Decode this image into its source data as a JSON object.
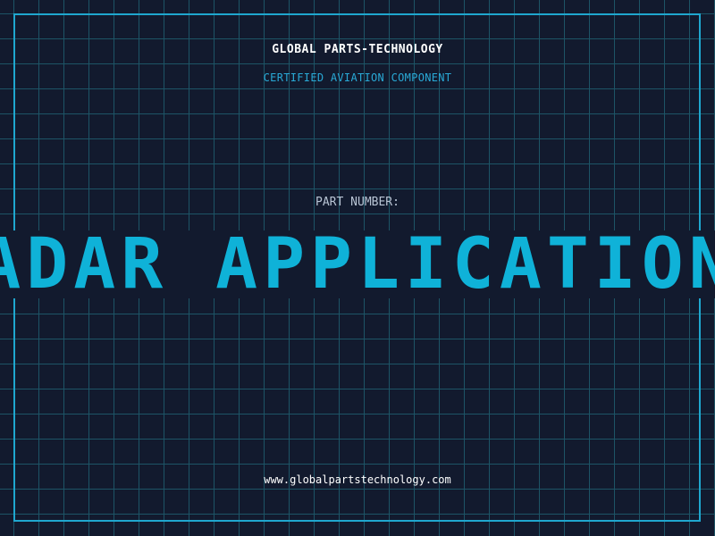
{
  "header": {
    "company": "GLOBAL PARTS-TECHNOLOGY",
    "subtitle": "CERTIFIED AVIATION COMPONENT"
  },
  "part": {
    "label": "PART NUMBER:",
    "value": "RADAR APPLICATIONS"
  },
  "footer": {
    "website": "www.globalpartstechnology.com"
  },
  "colors": {
    "background": "#121a2e",
    "grid": "#1d5466",
    "accent": "#0fb2d8",
    "frame": "#1fa7cf"
  }
}
